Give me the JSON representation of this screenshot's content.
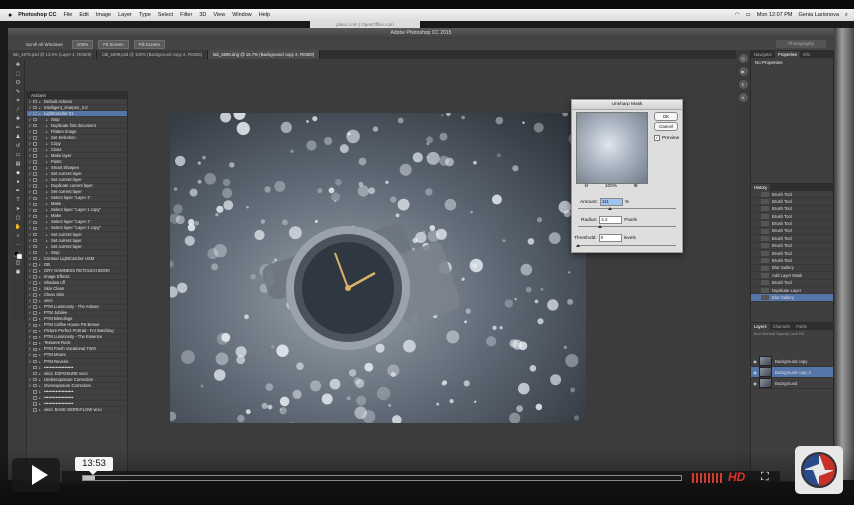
{
  "menubar": {
    "apple": "",
    "app": "Photoshop CC",
    "items": [
      "File",
      "Edit",
      "Image",
      "Layer",
      "Type",
      "Select",
      "Filter",
      "3D",
      "View",
      "Window",
      "Help"
    ],
    "clock": "Mon 12:07 PM",
    "user": "Genia Larionova"
  },
  "browser_url": "plasic.com | OpenOffice.com",
  "ps": {
    "title": "Adobe Photoshop CC 2015",
    "options": [
      "Scroll All Windows",
      "100%",
      "Fit Screen",
      "Fill Screen"
    ],
    "workspace": "Photography",
    "tabs": [
      "lab_4879.psd @ 12.5% (Layer 4, RGB/8)",
      "lab_5599.psd @ 100% (Background copy 2, RGB/8)",
      "lab_5598.dng @ 16.7% (Background copy 2, RGB/8)"
    ]
  },
  "actions": {
    "title": "Actions",
    "rows": [
      {
        "label": "Default Actions",
        "level": 0,
        "check": "✓",
        "hl": false
      },
      {
        "label": "Intelligent_sharpen_2.0",
        "level": 0,
        "check": "✓",
        "hl": false
      },
      {
        "label": "LightCatcher 01",
        "level": 0,
        "check": "✓",
        "hl": true
      },
      {
        "label": "Stop",
        "level": 1,
        "check": "✓",
        "hl": false
      },
      {
        "label": "Duplicate first document",
        "level": 1,
        "check": "✓",
        "hl": false
      },
      {
        "label": "Flatten Image",
        "level": 1,
        "check": "✓",
        "hl": false
      },
      {
        "label": "Set Selection",
        "level": 1,
        "check": "✓",
        "hl": false
      },
      {
        "label": "Copy",
        "level": 1,
        "check": "✓",
        "hl": false
      },
      {
        "label": "Close",
        "level": 1,
        "check": "✓",
        "hl": false
      },
      {
        "label": "Make layer",
        "level": 1,
        "check": "✓",
        "hl": false
      },
      {
        "label": "Paste",
        "level": 1,
        "check": "✓",
        "hl": false
      },
      {
        "label": "Smart Sharpen",
        "level": 1,
        "check": "✓",
        "hl": false
      },
      {
        "label": "Set current layer",
        "level": 1,
        "check": "✓",
        "hl": false
      },
      {
        "label": "Set current layer",
        "level": 1,
        "check": "✓",
        "hl": false
      },
      {
        "label": "Duplicate current layer",
        "level": 1,
        "check": "✓",
        "hl": false
      },
      {
        "label": "Set current layer",
        "level": 1,
        "check": "✓",
        "hl": false
      },
      {
        "label": "Select layer \"Layer 1\"",
        "level": 1,
        "check": "✓",
        "hl": false
      },
      {
        "label": "Make",
        "level": 1,
        "check": "✓",
        "hl": false
      },
      {
        "label": "Select layer \"Layer 1 copy\"",
        "level": 1,
        "check": "✓",
        "hl": false
      },
      {
        "label": "Make",
        "level": 1,
        "check": "✓",
        "hl": false
      },
      {
        "label": "Select layer \"Layer 1\"",
        "level": 1,
        "check": "✓",
        "hl": false
      },
      {
        "label": "Select layer \"Layer 1 copy\"",
        "level": 1,
        "check": "✓",
        "hl": false
      },
      {
        "label": "Set current layer",
        "level": 1,
        "check": "✓",
        "hl": false
      },
      {
        "label": "Set current layer",
        "level": 1,
        "check": "✓",
        "hl": false
      },
      {
        "label": "Set current layer",
        "level": 1,
        "check": "✓",
        "hl": false
      },
      {
        "label": "Stop",
        "level": 1,
        "check": "✓",
        "hl": false
      },
      {
        "label": "Contour LightCatcher USM",
        "level": 0,
        "check": "✓",
        "hl": false
      },
      {
        "label": "OB",
        "level": 0,
        "check": "✓",
        "hl": false
      },
      {
        "label": "GRY GAMNESS RETOUCH BOOK",
        "level": 0,
        "check": "✓",
        "hl": false
      },
      {
        "label": "Image Effects",
        "level": 0,
        "check": "✓",
        "hl": false
      },
      {
        "label": "Shadow off",
        "level": 0,
        "check": "✓",
        "hl": false
      },
      {
        "label": "Skin Clean",
        "level": 0,
        "check": "✓",
        "hl": false
      },
      {
        "label": "Clean Skin",
        "level": 0,
        "check": "✓",
        "hl": false
      },
      {
        "label": "vinci",
        "level": 0,
        "check": "✓",
        "hl": false
      },
      {
        "label": "PTM Luminosity - The Artisan",
        "level": 0,
        "check": "✓",
        "hl": false
      },
      {
        "label": "PTM Jubilee",
        "level": 0,
        "check": "✓",
        "hl": false
      },
      {
        "label": "PTM Blendings",
        "level": 0,
        "check": "✓",
        "hl": false
      },
      {
        "label": "PTM Coffee House PS Bonus",
        "level": 0,
        "check": "✓",
        "hl": false
      },
      {
        "label": "Picture Perfect Portrait - For Batching",
        "level": 0,
        "check": "✓",
        "hl": false
      },
      {
        "label": "PTM Luminosity - The Essence",
        "level": 0,
        "check": "✓",
        "hl": false
      },
      {
        "label": "Textures Rock",
        "level": 0,
        "check": "✓",
        "hl": false
      },
      {
        "label": "PTM Fresh Vacational TWO",
        "level": 0,
        "check": "✓",
        "hl": false
      },
      {
        "label": "PTM Moore",
        "level": 0,
        "check": "✓",
        "hl": false
      },
      {
        "label": "PTM Reverie",
        "level": 0,
        "check": "✓",
        "hl": false
      },
      {
        "label": "••••••••••••••••••••",
        "level": 0,
        "check": "",
        "hl": false
      },
      {
        "label": "vinci: EXPOSURE vinci",
        "level": 0,
        "check": "",
        "hl": false
      },
      {
        "label": "Underexposure Correction",
        "level": 0,
        "check": "✓",
        "hl": false
      },
      {
        "label": "Overexposure Correction",
        "level": 0,
        "check": "✓",
        "hl": false
      },
      {
        "label": "••••••••••••••••••••",
        "level": 0,
        "check": "",
        "hl": false
      },
      {
        "label": "••••••••••••••••••••",
        "level": 0,
        "check": "",
        "hl": false
      },
      {
        "label": "••••••••••••••••••••",
        "level": 0,
        "check": "",
        "hl": false
      },
      {
        "label": "vinci: BASE WORKFLOW vinci",
        "level": 0,
        "check": "",
        "hl": false
      }
    ]
  },
  "dialog": {
    "title": "Unsharp Mask",
    "ok": "OK",
    "cancel": "Cancel",
    "preview": "Preview",
    "preview_checked": "✓",
    "zoom": "100%",
    "zoom_out": "⊖",
    "zoom_in": "⊕",
    "amount_label": "Amount:",
    "amount_value": "111",
    "amount_unit": "%",
    "radius_label": "Radius:",
    "radius_value": "4.2",
    "radius_unit": "Pixels",
    "threshold_label": "Threshold:",
    "threshold_value": "0",
    "threshold_unit": "levels"
  },
  "properties": {
    "tabs": [
      "Navigator",
      "Properties",
      "Info"
    ],
    "active": "Properties",
    "content": "No Properties"
  },
  "history": {
    "title": "History",
    "rows": [
      {
        "label": "Brush Tool",
        "hl": false
      },
      {
        "label": "Brush Tool",
        "hl": false
      },
      {
        "label": "Brush Tool",
        "hl": false
      },
      {
        "label": "Brush Tool",
        "hl": false
      },
      {
        "label": "Brush Tool",
        "hl": false
      },
      {
        "label": "Brush Tool",
        "hl": false
      },
      {
        "label": "Brush Tool",
        "hl": false
      },
      {
        "label": "Brush Tool",
        "hl": false
      },
      {
        "label": "Brush Tool",
        "hl": false
      },
      {
        "label": "Brush Tool",
        "hl": false
      },
      {
        "label": "Blur Gallery",
        "hl": false
      },
      {
        "label": "Add Layer Mask",
        "hl": false
      },
      {
        "label": "Brush Tool",
        "hl": false
      },
      {
        "label": "Duplicate Layer",
        "hl": false
      },
      {
        "label": "Blur Gallery",
        "hl": true
      }
    ]
  },
  "layers": {
    "tabs": [
      "Layers",
      "Channels",
      "Paths"
    ],
    "controls": "Kind   Normal   Opacity   Lock   Fill",
    "rows": [
      {
        "label": "Background copy",
        "hl": false,
        "eye": "◉"
      },
      {
        "label": "Background copy 2",
        "hl": true,
        "eye": "◉"
      },
      {
        "label": "Background",
        "hl": false,
        "eye": "◉"
      }
    ]
  },
  "video": {
    "timecode": "13:53",
    "hd": "HD",
    "progress": 0.02
  },
  "icons": {
    "play": "play-icon",
    "volume": "volume-icon",
    "fullscreen": "fullscreen-icon",
    "logo": "aperture-logo-icon"
  }
}
